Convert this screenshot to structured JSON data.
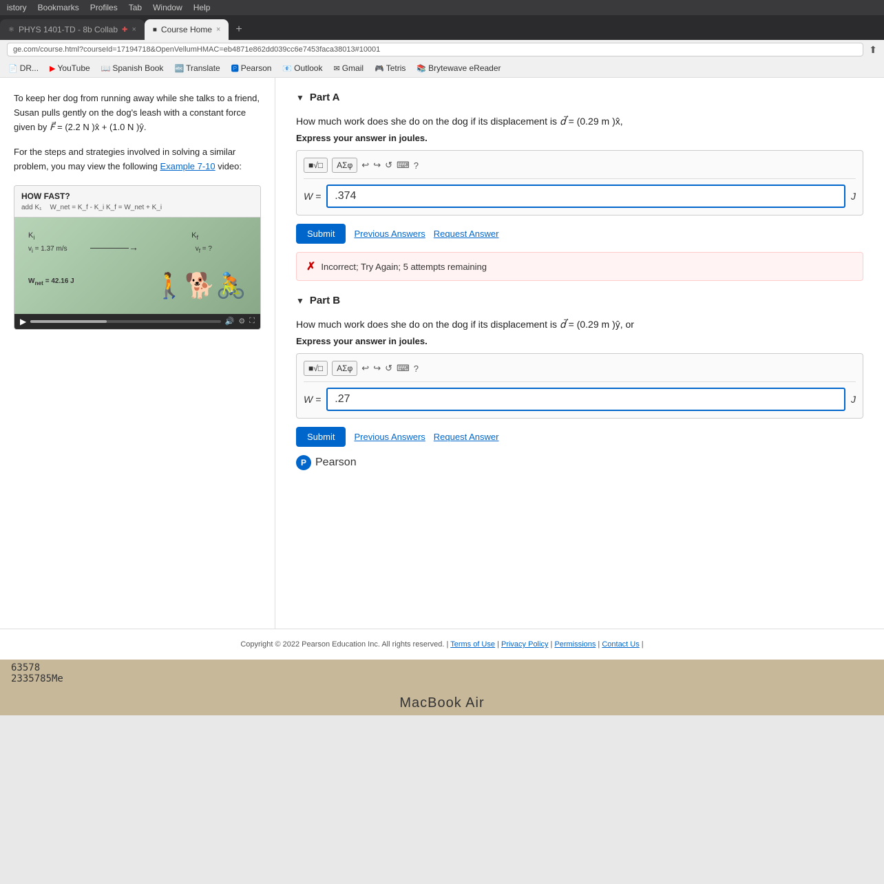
{
  "browser": {
    "menu_items": [
      "istory",
      "Bookmarks",
      "Profiles",
      "Tab",
      "Window",
      "Help"
    ],
    "tab_active": "Course Home",
    "tab_other": "PHYS 1401-TD - 8b Collab",
    "tab_close": "×",
    "tab_plus": "+",
    "address": "ge.com/course.html?courseId=17194718&OpenVellumHMAC=eb4871e862dd039cc6e7453faca38013#10001",
    "bookmarks": [
      {
        "label": "DR...",
        "icon": "📄"
      },
      {
        "label": "YouTube",
        "icon": "▶"
      },
      {
        "label": "Spanish Book",
        "icon": "📖"
      },
      {
        "label": "Translate",
        "icon": "🔤"
      },
      {
        "label": "Pearson",
        "icon": "🅿"
      },
      {
        "label": "Outlook",
        "icon": "📧"
      },
      {
        "label": "Gmail",
        "icon": "✉"
      },
      {
        "label": "Tetris",
        "icon": "🎮"
      },
      {
        "label": "Brytewave eReader",
        "icon": "📚"
      }
    ]
  },
  "left_panel": {
    "problem_text": "To keep her dog from running away while she talks to a friend, Susan pulls gently on the dog's leash with a constant force given by F⃗ = (2.2 N )x̂ + (1.0 N )ŷ.",
    "strategy_text": "For the steps and strategies involved in solving a similar problem, you may view the following",
    "example_link": "Example 7-10",
    "video_suffix": "video:",
    "video_title": "HOW FAST?",
    "video_eq1": "add K₁",
    "video_eq2": "W_net = K_f - K_i     K_f = W_net + K_i",
    "video_caption1": "K_i",
    "video_caption2": "v_i = 1.37 m/s",
    "video_caption3": "K_f",
    "video_caption4": "v_f = ?",
    "video_energy": "W_net = 42.16 J"
  },
  "part_a": {
    "label": "Part A",
    "question": "How much work does she do on the dog if its displacement is d⃗ = (0.29 m )x̂,",
    "express_label": "Express your answer in joules.",
    "toolbar_buttons": [
      "■√□",
      "ΑΣφ"
    ],
    "toolbar_icons": [
      "↩",
      "↪",
      "↺",
      "⌨",
      "?"
    ],
    "input_prefix": "W =",
    "input_value": ".374",
    "unit": "J",
    "submit_label": "Submit",
    "prev_answers_label": "Previous Answers",
    "request_answer_label": "Request Answer",
    "error_text": "Incorrect; Try Again; 5 attempts remaining"
  },
  "part_b": {
    "label": "Part B",
    "question": "How much work does she do on the dog if its displacement is d⃗ = (0.29 m )ŷ, or",
    "express_label": "Express your answer in joules.",
    "toolbar_buttons": [
      "■√□",
      "ΑΣφ"
    ],
    "toolbar_icons": [
      "↩",
      "↪",
      "↺",
      "⌨",
      "?"
    ],
    "input_prefix": "W =",
    "input_value": ".27",
    "unit": "J",
    "submit_label": "Submit",
    "prev_answers_label": "Previous Answers",
    "request_answer_label": "Request Answer"
  },
  "pearson": {
    "logo_letter": "P",
    "logo_text": "Pearson"
  },
  "footer": {
    "copyright": "Copyright © 2022 Pearson Education Inc. All rights reserved.",
    "links": [
      "Terms of Use",
      "Privacy Policy",
      "Permissions",
      "Contact Us"
    ]
  },
  "taskbar": {
    "notes1": "63578",
    "notes2": "2335785Me",
    "macbook_label": "MacBook Air"
  }
}
